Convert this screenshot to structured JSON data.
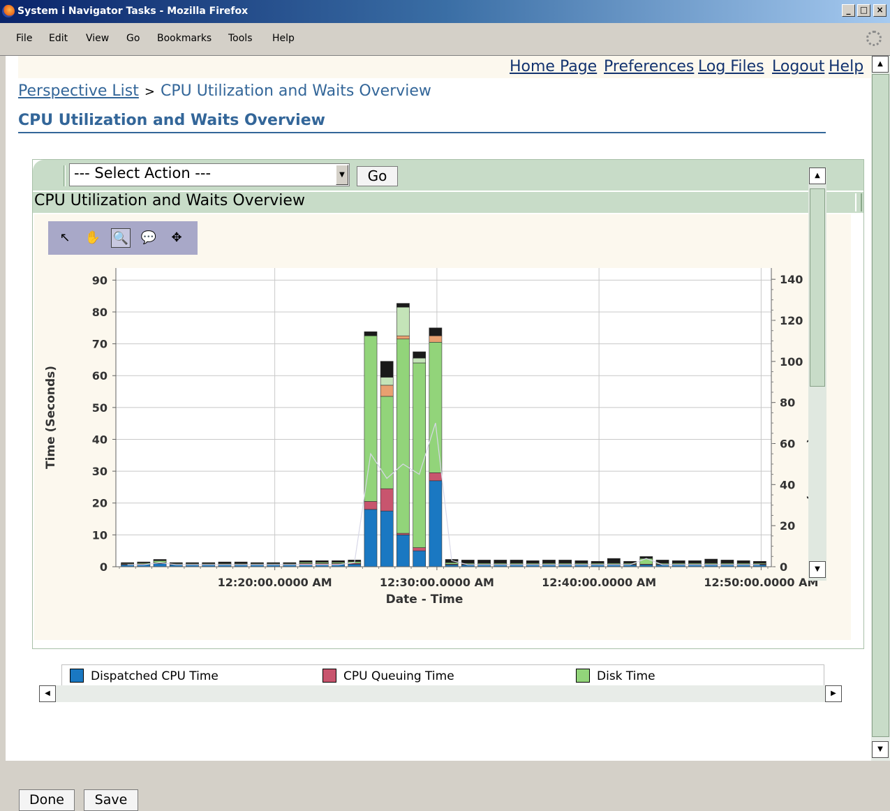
{
  "window": {
    "title": "System i Navigator Tasks - Mozilla Firefox",
    "controls": [
      "_",
      "□",
      "×"
    ]
  },
  "menu": [
    "File",
    "Edit",
    "View",
    "Go",
    "Bookmarks",
    "Tools",
    "Help"
  ],
  "top_links": [
    "Home Page",
    "Preferences",
    "Log Files",
    "Logout",
    "Help"
  ],
  "breadcrumb": {
    "root": "Perspective List",
    "separator": ">",
    "current": "CPU Utilization and Waits Overview"
  },
  "page_title": "CPU Utilization and Waits Overview",
  "action_bar": {
    "select_value": "--- Select Action ---",
    "go_label": "Go"
  },
  "panel_title": "CPU Utilization and Waits Overview",
  "toolbar_tools": [
    {
      "name": "pointer-tool-icon",
      "glyph": "↖"
    },
    {
      "name": "pan-hand-icon",
      "glyph": "✋"
    },
    {
      "name": "zoom-tool-icon",
      "glyph": "🔍"
    },
    {
      "name": "tooltip-tool-icon",
      "glyph": "💬"
    },
    {
      "name": "reset-view-icon",
      "glyph": "✥"
    }
  ],
  "colors": {
    "dispatched": "#1a78c2",
    "queuing": "#c8556e",
    "disk": "#92d47a",
    "other": "#e8a070",
    "dark": "#1a1a1a",
    "light": "#c4e4b8"
  },
  "chart_data": {
    "type": "bar",
    "stacked": true,
    "xlabel": "Date - Time",
    "ylabel": "Time (Seconds)",
    "y2label": "CPU Utilization (Percent)",
    "ylim": [
      0,
      90
    ],
    "y2lim": [
      0,
      140
    ],
    "yticks": [
      0,
      10,
      20,
      30,
      40,
      50,
      60,
      70,
      80,
      90
    ],
    "y2ticks": [
      0,
      20,
      40,
      60,
      80,
      100,
      120,
      140
    ],
    "xtick_labels": [
      "12:20:00.0000 AM",
      "12:30:00.0000 AM",
      "12:40:00.0000 AM",
      "12:50:00.0000 AM"
    ],
    "legend": [
      "Dispatched CPU Time",
      "CPU Queuing Time",
      "Disk Time"
    ],
    "bar_count": 40,
    "series": [
      {
        "name": "Dispatched CPU Time",
        "values": [
          0.6,
          0.7,
          1.0,
          0.6,
          0.6,
          0.6,
          0.6,
          0.6,
          0.6,
          0.6,
          0.6,
          0.7,
          0.7,
          0.7,
          0.8,
          18,
          17.5,
          10,
          5,
          27,
          0.6,
          0.6,
          0.6,
          0.6,
          0.6,
          0.6,
          0.6,
          0.6,
          0.6,
          0.6,
          0.6,
          0.6,
          0.6,
          0.6,
          0.6,
          0.6,
          0.6,
          0.6,
          0.6,
          0.6
        ]
      },
      {
        "name": "CPU Queuing Time",
        "values": [
          0.2,
          0.2,
          0.3,
          0.2,
          0.2,
          0.2,
          0.2,
          0.2,
          0.2,
          0.2,
          0.2,
          0.3,
          0.3,
          0.3,
          0.3,
          2.5,
          7,
          0.5,
          1,
          2.5,
          0.2,
          0.2,
          0.2,
          0.2,
          0.2,
          0.2,
          0.2,
          0.2,
          0.2,
          0.2,
          0.2,
          0.2,
          0.2,
          0.2,
          0.2,
          0.2,
          0.2,
          0.2,
          0.2,
          0.2
        ]
      },
      {
        "name": "Disk Time",
        "values": [
          0.2,
          0.3,
          0.6,
          0.2,
          0.2,
          0.2,
          0.2,
          0.2,
          0.2,
          0.2,
          0.2,
          0.4,
          0.4,
          0.4,
          0.5,
          52,
          29,
          61,
          58,
          41,
          0.5,
          0.3,
          0.3,
          0.3,
          0.3,
          0.3,
          0.3,
          0.3,
          0.3,
          0.3,
          0.3,
          0.3,
          1.8,
          0.3,
          0.3,
          0.3,
          0.3,
          0.3,
          0.3,
          0.3
        ]
      },
      {
        "name": "",
        "values": [
          0.3,
          0.3,
          0.4,
          0.3,
          0.3,
          0.3,
          0.5,
          0.5,
          0.3,
          0.3,
          0.3,
          0.5,
          0.5,
          0.5,
          0.5,
          1.3,
          5,
          1.2,
          2,
          2.5,
          1,
          1,
          1,
          1,
          1,
          0.8,
          1,
          1,
          0.8,
          0.6,
          1.5,
          0.6,
          0.6,
          1,
          0.8,
          0.8,
          1.3,
          1,
          0.8,
          0.6
        ]
      }
    ],
    "extra_segments": [
      {
        "index": 16,
        "values": [
          {
            "v": 3.5,
            "c": "other"
          },
          {
            "v": 2.5,
            "c": "light"
          }
        ]
      },
      {
        "index": 17,
        "values": [
          {
            "v": 1,
            "c": "other"
          },
          {
            "v": 9,
            "c": "light"
          }
        ]
      },
      {
        "index": 18,
        "values": [
          {
            "v": 1.5,
            "c": "light"
          }
        ]
      },
      {
        "index": 19,
        "values": [
          {
            "v": 2,
            "c": "other"
          }
        ]
      }
    ],
    "cpu_utilization_line": [
      1,
      1,
      2,
      1,
      1,
      1,
      1,
      1,
      1,
      1,
      1,
      1,
      1,
      1,
      2,
      55,
      43,
      50,
      45,
      70,
      3,
      1,
      1,
      1,
      1,
      1,
      1,
      1,
      1,
      1,
      1,
      1,
      4,
      1,
      1,
      1,
      1,
      1,
      1,
      1
    ]
  },
  "legend_items": [
    "Dispatched CPU Time",
    "CPU Queuing Time",
    "Disk Time"
  ],
  "buttons": {
    "done": "Done",
    "save": "Save"
  }
}
